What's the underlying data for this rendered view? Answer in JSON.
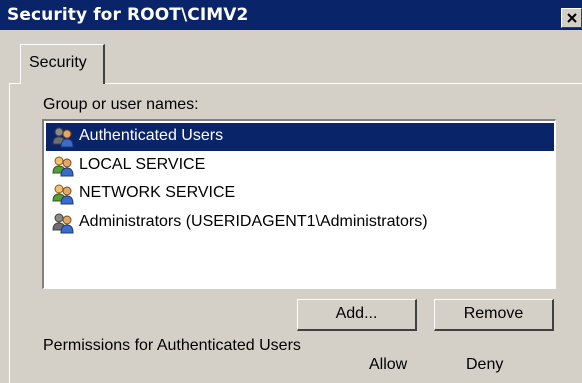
{
  "window": {
    "title": "Security for ROOT\\CIMV2",
    "close_icon": "close-icon"
  },
  "tabs": [
    {
      "label": "Security",
      "active": true
    }
  ],
  "group_list": {
    "label": "Group or user names:",
    "items": [
      {
        "label": "Authenticated Users",
        "icon": "users-group-icon",
        "selected": true
      },
      {
        "label": "LOCAL SERVICE",
        "icon": "users-group-icon",
        "selected": false
      },
      {
        "label": "NETWORK SERVICE",
        "icon": "users-group-icon",
        "selected": false
      },
      {
        "label": "Administrators (USERIDAGENT1\\Administrators)",
        "icon": "users-group-icon",
        "selected": false
      }
    ]
  },
  "buttons": {
    "add": "Add...",
    "remove": "Remove"
  },
  "permissions": {
    "label": "Permissions for Authenticated Users",
    "col_allow": "Allow",
    "col_deny": "Deny"
  },
  "colors": {
    "titlebar": "#0a246a",
    "selection": "#0a246a",
    "face": "#d4d0c8"
  }
}
